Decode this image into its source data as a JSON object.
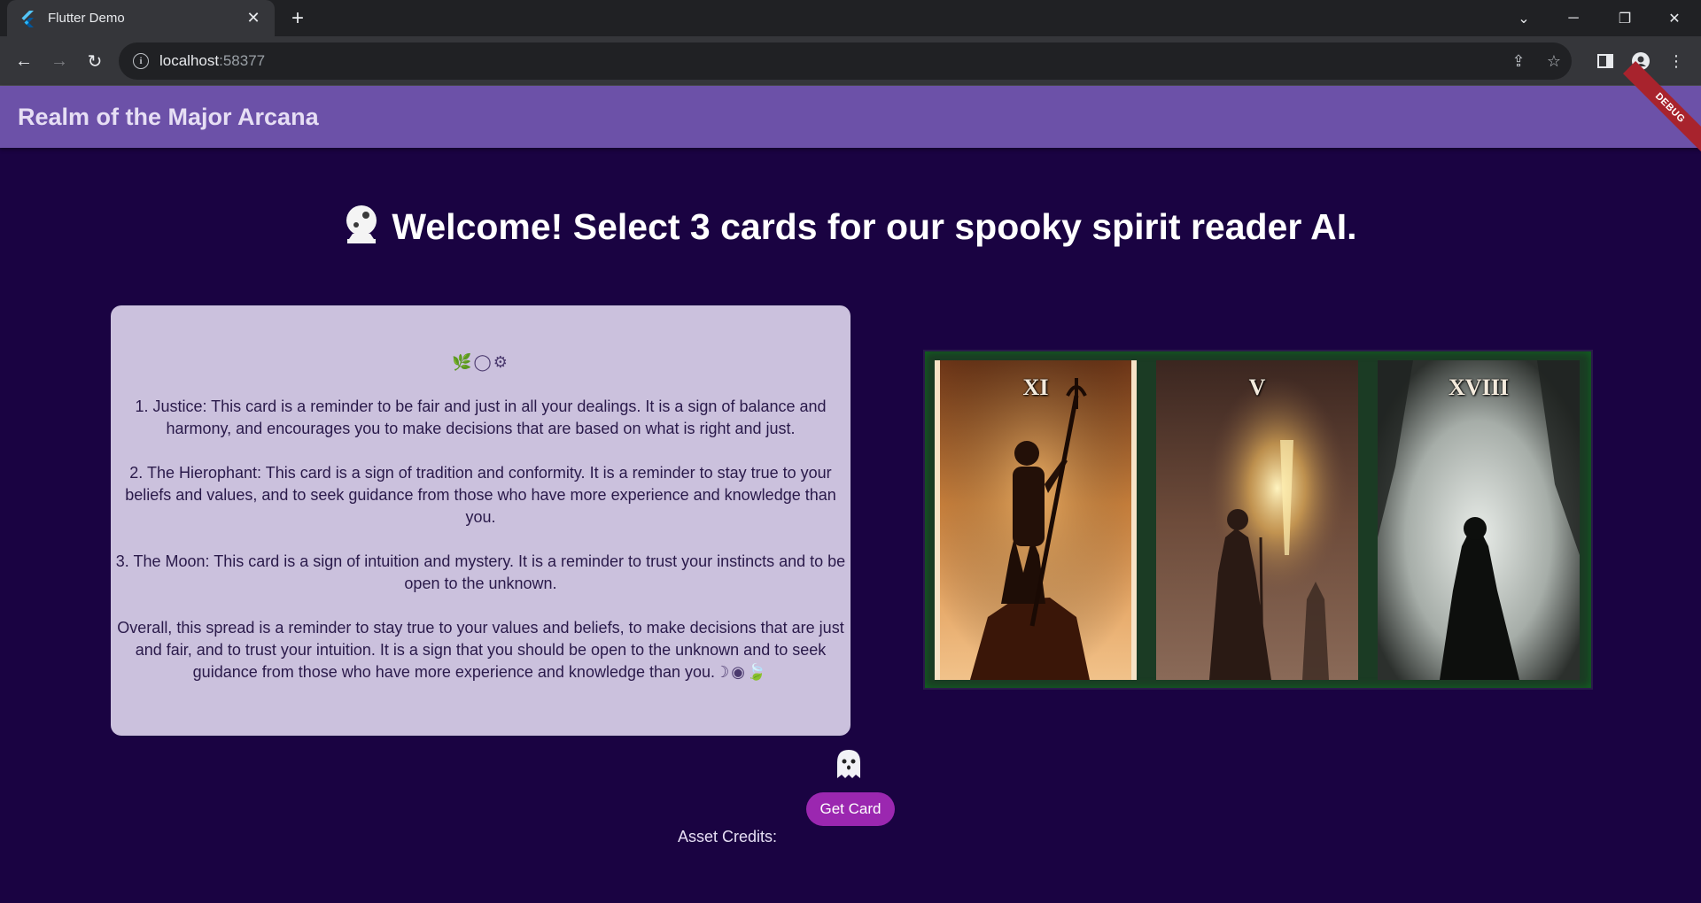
{
  "browser": {
    "tab_title": "Flutter Demo",
    "url_host": "localhost",
    "url_port": ":58377"
  },
  "app": {
    "title": "Realm of the Major Arcana",
    "debug_banner": "DEBUG",
    "headline": "Welcome! Select 3 cards for our spooky spirit reader AI."
  },
  "reading": {
    "symbols_top": "🌿◯⚙",
    "paragraphs": [
      "1. Justice: This card is a reminder to be fair and just in all your dealings. It is a sign of balance and harmony, and encourages you to make decisions that are based on what is right and just.",
      "2. The Hierophant: This card is a sign of tradition and conformity. It is a reminder to stay true to your beliefs and values, and to seek guidance from those who have more experience and knowledge than you.",
      "3. The Moon: This card is a sign of intuition and mystery. It is a reminder to trust your instincts and to be open to the unknown."
    ],
    "summary": "Overall, this spread is a reminder to stay true to your values and beliefs, to make decisions that are just and fair, and to trust your intuition. It is a sign that you should be open to the unknown and to seek guidance from those who have more experience and knowledge than you.",
    "symbols_end": "☽◉🍃"
  },
  "cards": [
    {
      "numeral": "XI",
      "name": "Justice"
    },
    {
      "numeral": "V",
      "name": "The Hierophant"
    },
    {
      "numeral": "XVIII",
      "name": "The Moon"
    }
  ],
  "actions": {
    "get_card_label": "Get Card",
    "credits_label": "Asset Credits:"
  },
  "colors": {
    "page_bg": "#1a0342",
    "appbar": "#6c51a8",
    "panel": "#cbc1dd",
    "button": "#9b27b0"
  }
}
